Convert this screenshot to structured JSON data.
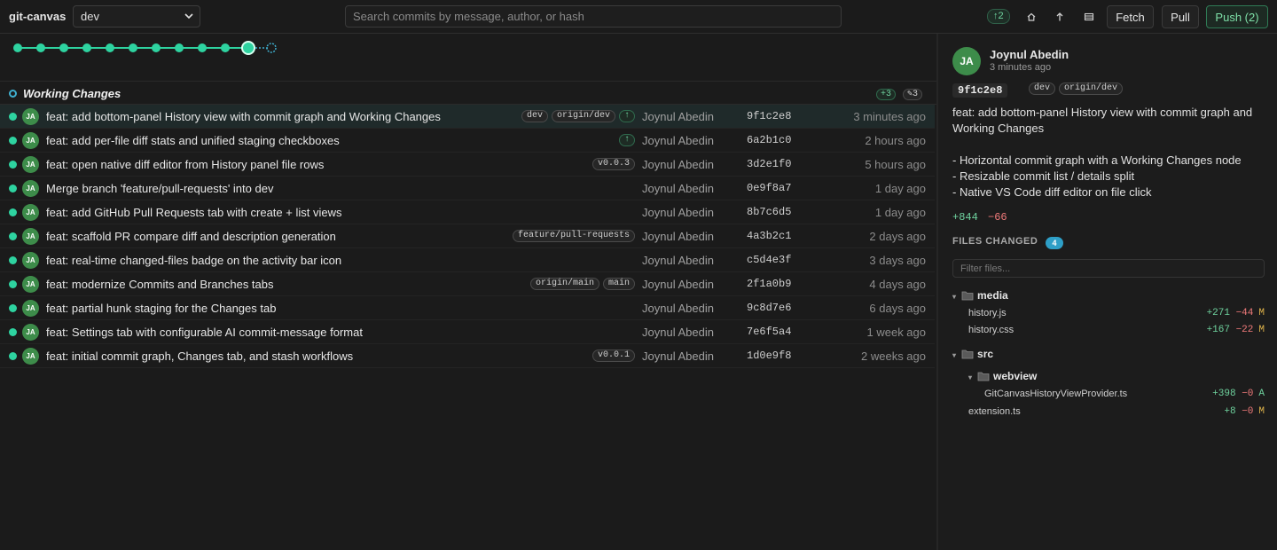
{
  "app": {
    "title": "git-canvas"
  },
  "branch_select": {
    "value": "dev"
  },
  "search": {
    "placeholder": "Search commits by message, author, or hash"
  },
  "toolbar": {
    "ahead_label": "↑2",
    "fetch_label": "Fetch",
    "pull_label": "Pull",
    "push_label": "Push (2)",
    "icons": [
      "home-icon",
      "arrow-up-icon",
      "panel-icon"
    ]
  },
  "graph": {
    "commit_count": 11,
    "has_working_changes_node": true,
    "accent": "#2ed3a0"
  },
  "working_changes": {
    "label": "Working Changes",
    "added": "+3",
    "modified": "✎3"
  },
  "commits": [
    {
      "message": "feat: add bottom-panel History view with commit graph and Working Changes",
      "refs": [
        "dev",
        "origin/dev"
      ],
      "unpushed": true,
      "initials": "JA",
      "author": "Joynul Abedin",
      "hash": "9f1c2e8",
      "time": "3 minutes ago",
      "selected": true
    },
    {
      "message": "feat: add per-file diff stats and unified staging checkboxes",
      "refs": [],
      "unpushed": true,
      "initials": "JA",
      "author": "Joynul Abedin",
      "hash": "6a2b1c0",
      "time": "2 hours ago"
    },
    {
      "message": "feat: open native diff editor from History panel file rows",
      "refs": [
        "v0.0.3"
      ],
      "unpushed": false,
      "initials": "JA",
      "author": "Joynul Abedin",
      "hash": "3d2e1f0",
      "time": "5 hours ago"
    },
    {
      "message": "Merge branch 'feature/pull-requests' into dev",
      "refs": [],
      "unpushed": false,
      "initials": "JA",
      "author": "Joynul Abedin",
      "hash": "0e9f8a7",
      "time": "1 day ago"
    },
    {
      "message": "feat: add GitHub Pull Requests tab with create + list views",
      "refs": [],
      "unpushed": false,
      "initials": "JA",
      "author": "Joynul Abedin",
      "hash": "8b7c6d5",
      "time": "1 day ago"
    },
    {
      "message": "feat: scaffold PR compare diff and description generation",
      "refs": [
        "feature/pull-requests"
      ],
      "unpushed": false,
      "initials": "JA",
      "author": "Joynul Abedin",
      "hash": "4a3b2c1",
      "time": "2 days ago"
    },
    {
      "message": "feat: real-time changed-files badge on the activity bar icon",
      "refs": [],
      "unpushed": false,
      "initials": "JA",
      "author": "Joynul Abedin",
      "hash": "c5d4e3f",
      "time": "3 days ago"
    },
    {
      "message": "feat: modernize Commits and Branches tabs",
      "refs": [
        "origin/main",
        "main"
      ],
      "unpushed": false,
      "initials": "JA",
      "author": "Joynul Abedin",
      "hash": "2f1a0b9",
      "time": "4 days ago"
    },
    {
      "message": "feat: partial hunk staging for the Changes tab",
      "refs": [],
      "unpushed": false,
      "initials": "JA",
      "author": "Joynul Abedin",
      "hash": "9c8d7e6",
      "time": "6 days ago"
    },
    {
      "message": "feat: Settings tab with configurable AI commit-message format",
      "refs": [],
      "unpushed": false,
      "initials": "JA",
      "author": "Joynul Abedin",
      "hash": "7e6f5a4",
      "time": "1 week ago"
    },
    {
      "message": "feat: initial commit graph, Changes tab, and stash workflows",
      "refs": [
        "v0.0.1"
      ],
      "unpushed": false,
      "initials": "JA",
      "author": "Joynul Abedin",
      "hash": "1d0e9f8",
      "time": "2 weeks ago"
    }
  ],
  "unpushed_marker": "↑",
  "details": {
    "initials": "JA",
    "author": "Joynul Abedin",
    "time": "3 minutes ago",
    "hash": "9f1c2e8",
    "refs": [
      "dev",
      "origin/dev"
    ],
    "message_lines": [
      "feat: add bottom-panel History view with commit graph and Working Changes",
      "",
      "- Horizontal commit graph with a Working Changes node",
      "- Resizable commit list / details split",
      "- Native VS Code diff editor on file click"
    ],
    "additions": "+844",
    "deletions": "−66",
    "files_label": "FILES CHANGED",
    "files_count": "4",
    "filter_placeholder": "Filter files...",
    "tree": [
      {
        "type": "folder",
        "name": "media",
        "depth": 0
      },
      {
        "type": "file",
        "name": "history.js",
        "depth": 1,
        "add": "+271",
        "del": "−44",
        "status": "M"
      },
      {
        "type": "file",
        "name": "history.css",
        "depth": 1,
        "add": "+167",
        "del": "−22",
        "status": "M"
      },
      {
        "type": "folder",
        "name": "src",
        "depth": 0
      },
      {
        "type": "folder",
        "name": "webview",
        "depth": 1
      },
      {
        "type": "file",
        "name": "GitCanvasHistoryViewProvider.ts",
        "depth": 2,
        "add": "+398",
        "del": "−0",
        "status": "A"
      },
      {
        "type": "file",
        "name": "extension.ts",
        "depth": 1,
        "add": "+8",
        "del": "−0",
        "status": "M"
      }
    ]
  },
  "colors": {
    "accent": "#2ed3a0",
    "avatar": "#3d8c4a",
    "added": "#6fd39f",
    "deleted": "#f07a7a",
    "modified": "#e0b44b",
    "badge": "#2e9fc7"
  }
}
